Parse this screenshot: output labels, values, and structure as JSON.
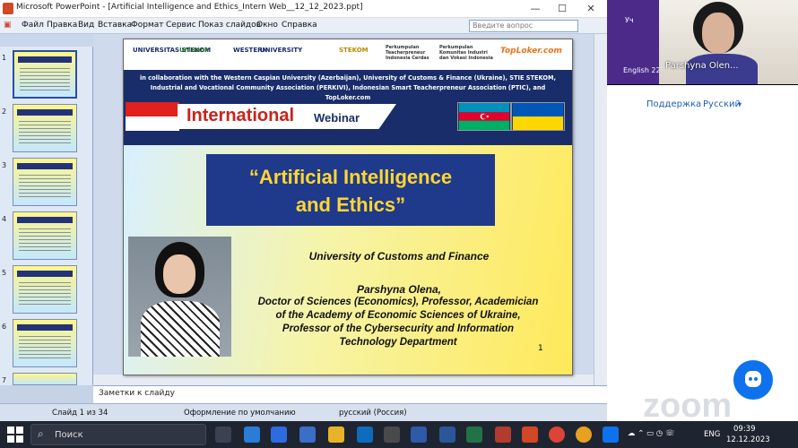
{
  "ppt": {
    "title": "Microsoft PowerPoint - [Artificial Intelligence and Ethics_Intern Web__12_12_2023.ppt]",
    "window_buttons": [
      "—",
      "☐",
      "✕"
    ],
    "menu": [
      "Файл",
      "Правка",
      "Вид",
      "Вставка",
      "Формат",
      "Сервис",
      "Показ слайдов",
      "Окно",
      "Справка"
    ],
    "question_placeholder": "Введите вопрос",
    "slide_numbers": [
      "1",
      "2",
      "3",
      "4",
      "5",
      "6",
      "7"
    ],
    "notes_placeholder": "Заметки к слайду",
    "status": {
      "slide": "Слайд 1 из 34",
      "design": "Оформление по умолчанию",
      "lang": "русский (Россия)"
    }
  },
  "slide": {
    "logos": [
      "UNIVERSITAS STEKOM",
      "UniRank",
      "WESTERN",
      "UNIVERSITY",
      "STEKOM",
      "Perkumpulan Teacherpreneur Indonesia Cerdas",
      "Perkumpulan Komunitas Industri dan Vokasi Indonesia",
      "TopLoker.com"
    ],
    "collab": "in collaboration with the Western Caspian University (Azerbaijan), University of Customs & Finance (Ukraine), STIE STEKOM, Industrial and Vocational Community Association (PERKIVI), Indonesian Smart Teacherpreneur Association (PTIC), and TopLoker.com",
    "intl_a": "International",
    "intl_b": "Webinar",
    "title_line1": "“Artificial Intelligence",
    "title_line2": "and Ethics”",
    "university": "University of Customs and Finance",
    "name": "Parshyna Olena,",
    "desc1": "Doctor of Sciences (Economics), Professor, Academician",
    "desc2": "of the Academy of Economic Sciences of Ukraine,",
    "desc3": "Professor of the Cybersecurity and Information",
    "desc4": "Technology Department",
    "number": "1"
  },
  "zoom": {
    "participant_name": "Parshyna Olen...",
    "small_tile_label": "Уч",
    "english_label": "English 22",
    "support": "Поддержка",
    "language": "Русский",
    "logo": "zoom"
  },
  "taskbar": {
    "search": "Поиск",
    "lang": "ENG",
    "time": "09:39",
    "date": "12.12.2023"
  },
  "colors": {
    "slide_navy": "#1a2d6b",
    "title_gold": "#ffd633",
    "intl_red": "#c8231c",
    "zoom_blue": "#0e72ed"
  }
}
